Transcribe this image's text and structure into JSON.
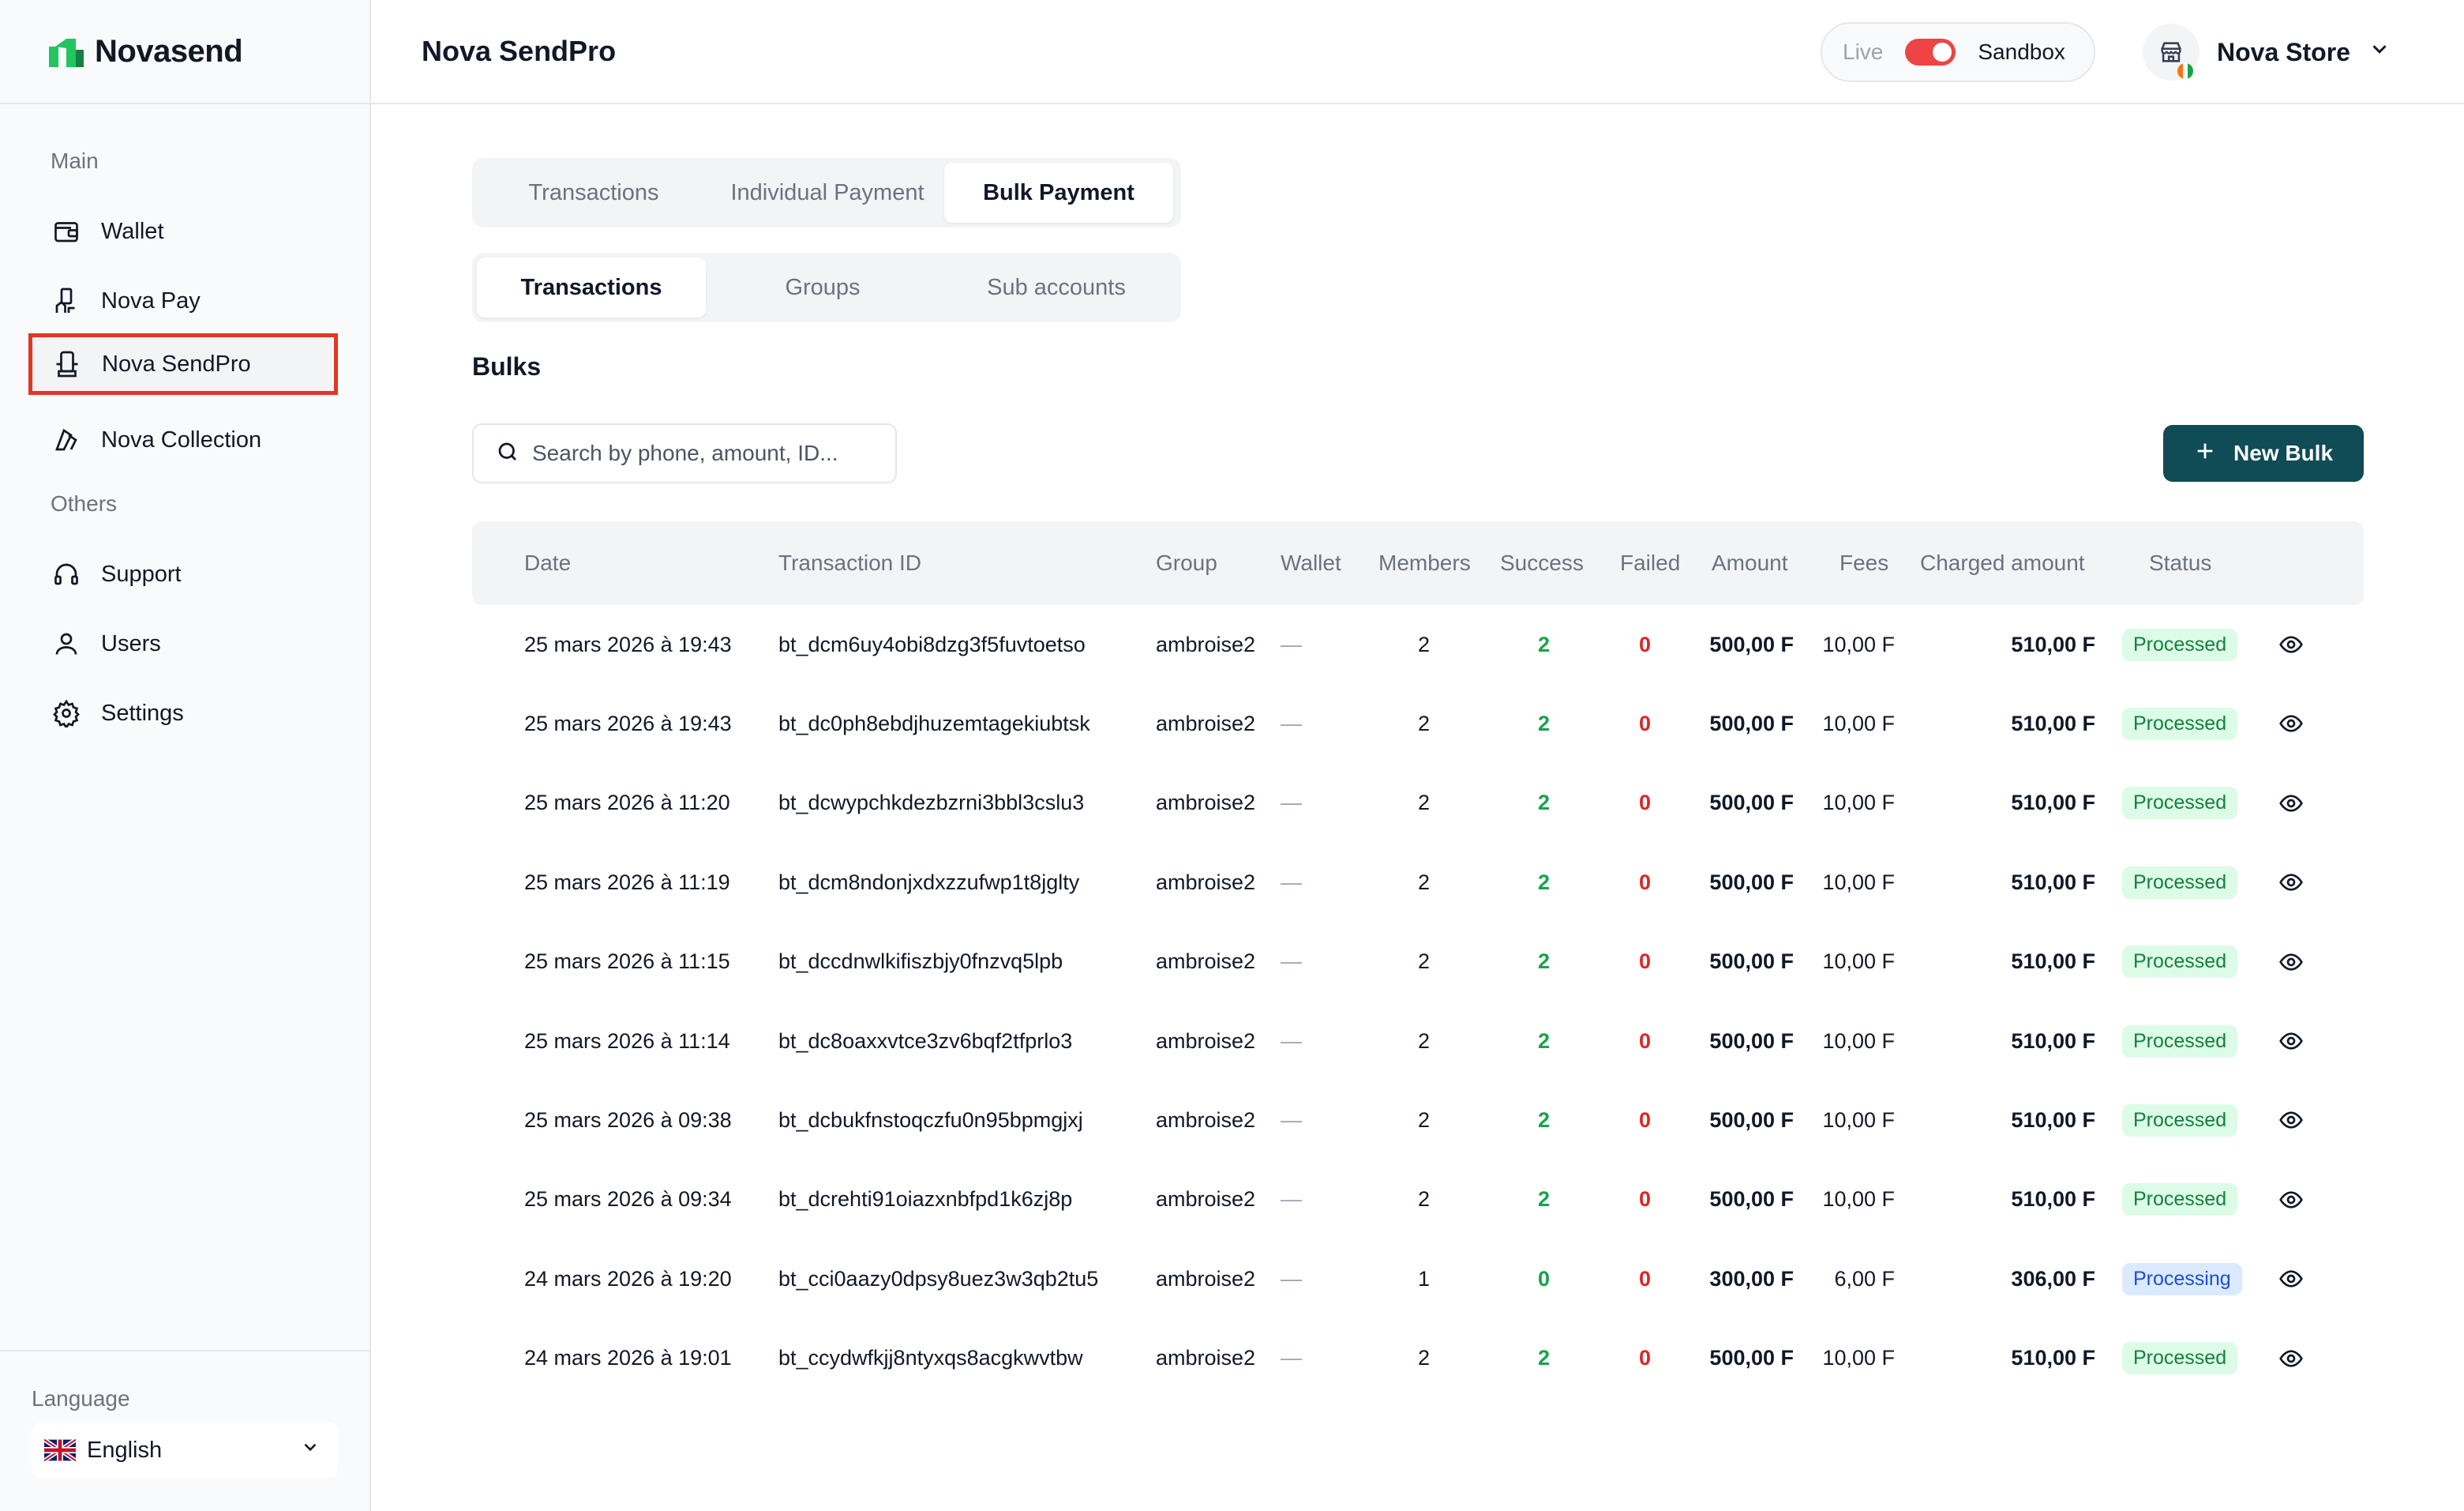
{
  "brand": {
    "name": "Novasend",
    "color": "#22c55e"
  },
  "sidebar": {
    "main_label": "Main",
    "others_label": "Others",
    "main_items": [
      {
        "label": "Wallet",
        "icon": "wallet-icon"
      },
      {
        "label": "Nova Pay",
        "icon": "hand-pay-icon"
      },
      {
        "label": "Nova SendPro",
        "icon": "send-pro-icon",
        "active": true
      },
      {
        "label": "Nova Collection",
        "icon": "collection-icon"
      }
    ],
    "other_items": [
      {
        "label": "Support",
        "icon": "headset-icon"
      },
      {
        "label": "Users",
        "icon": "user-icon"
      },
      {
        "label": "Settings",
        "icon": "gear-icon"
      }
    ],
    "language_label": "Language",
    "language_value": "English"
  },
  "header": {
    "title": "Nova SendPro",
    "env_live": "Live",
    "env_sandbox": "Sandbox",
    "store_name": "Nova Store"
  },
  "tabs_top": [
    "Transactions",
    "Individual Payment",
    "Bulk Payment"
  ],
  "tabs_top_active": "Bulk Payment",
  "tabs_sub": [
    "Transactions",
    "Groups",
    "Sub accounts"
  ],
  "tabs_sub_active": "Transactions",
  "section_title": "Bulks",
  "search": {
    "placeholder": "Search by phone, amount, ID..."
  },
  "new_bulk_label": "New Bulk",
  "table": {
    "columns": [
      "Date",
      "Transaction ID",
      "Group",
      "Wallet",
      "Members",
      "Success",
      "Failed",
      "Amount",
      "Fees",
      "Charged amount",
      "Status"
    ],
    "rows": [
      {
        "date": "25 mars 2026 à 19:43",
        "id": "bt_dcm6uy4obi8dzg3f5fuvtoetso",
        "group": "ambroise2",
        "wallet": "—",
        "members": "2",
        "success": "2",
        "failed": "0",
        "amount": "500,00 F",
        "fees": "10,00 F",
        "charged": "510,00 F",
        "status": "Processed"
      },
      {
        "date": "25 mars 2026 à 19:43",
        "id": "bt_dc0ph8ebdjhuzemtagekiubtsk",
        "group": "ambroise2",
        "wallet": "—",
        "members": "2",
        "success": "2",
        "failed": "0",
        "amount": "500,00 F",
        "fees": "10,00 F",
        "charged": "510,00 F",
        "status": "Processed"
      },
      {
        "date": "25 mars 2026 à 11:20",
        "id": "bt_dcwypchkdezbzrni3bbl3cslu3",
        "group": "ambroise2",
        "wallet": "—",
        "members": "2",
        "success": "2",
        "failed": "0",
        "amount": "500,00 F",
        "fees": "10,00 F",
        "charged": "510,00 F",
        "status": "Processed"
      },
      {
        "date": "25 mars 2026 à 11:19",
        "id": "bt_dcm8ndonjxdxzzufwp1t8jglty",
        "group": "ambroise2",
        "wallet": "—",
        "members": "2",
        "success": "2",
        "failed": "0",
        "amount": "500,00 F",
        "fees": "10,00 F",
        "charged": "510,00 F",
        "status": "Processed"
      },
      {
        "date": "25 mars 2026 à 11:15",
        "id": "bt_dccdnwlkifiszbjy0fnzvq5lpb",
        "group": "ambroise2",
        "wallet": "—",
        "members": "2",
        "success": "2",
        "failed": "0",
        "amount": "500,00 F",
        "fees": "10,00 F",
        "charged": "510,00 F",
        "status": "Processed"
      },
      {
        "date": "25 mars 2026 à 11:14",
        "id": "bt_dc8oaxxvtce3zv6bqf2tfprlo3",
        "group": "ambroise2",
        "wallet": "—",
        "members": "2",
        "success": "2",
        "failed": "0",
        "amount": "500,00 F",
        "fees": "10,00 F",
        "charged": "510,00 F",
        "status": "Processed"
      },
      {
        "date": "25 mars 2026 à 09:38",
        "id": "bt_dcbukfnstoqczfu0n95bpmgjxj",
        "group": "ambroise2",
        "wallet": "—",
        "members": "2",
        "success": "2",
        "failed": "0",
        "amount": "500,00 F",
        "fees": "10,00 F",
        "charged": "510,00 F",
        "status": "Processed"
      },
      {
        "date": "25 mars 2026 à 09:34",
        "id": "bt_dcrehti91oiazxnbfpd1k6zj8p",
        "group": "ambroise2",
        "wallet": "—",
        "members": "2",
        "success": "2",
        "failed": "0",
        "amount": "500,00 F",
        "fees": "10,00 F",
        "charged": "510,00 F",
        "status": "Processed"
      },
      {
        "date": "24 mars 2026 à 19:20",
        "id": "bt_cci0aazy0dpsy8uez3w3qb2tu5",
        "group": "ambroise2",
        "wallet": "—",
        "members": "1",
        "success": "0",
        "failed": "0",
        "amount": "300,00 F",
        "fees": "6,00 F",
        "charged": "306,00 F",
        "status": "Processing"
      },
      {
        "date": "24 mars 2026 à 19:01",
        "id": "bt_ccydwfkjj8ntyxqs8acgkwvtbw",
        "group": "ambroise2",
        "wallet": "—",
        "members": "2",
        "success": "2",
        "failed": "0",
        "amount": "500,00 F",
        "fees": "10,00 F",
        "charged": "510,00 F",
        "status": "Processed"
      }
    ]
  },
  "colors": {
    "primary_button": "#0f4c55",
    "success": "#16a34a",
    "failed": "#dc2626",
    "toggle": "#ef4444",
    "highlight_border": "#e53525"
  }
}
